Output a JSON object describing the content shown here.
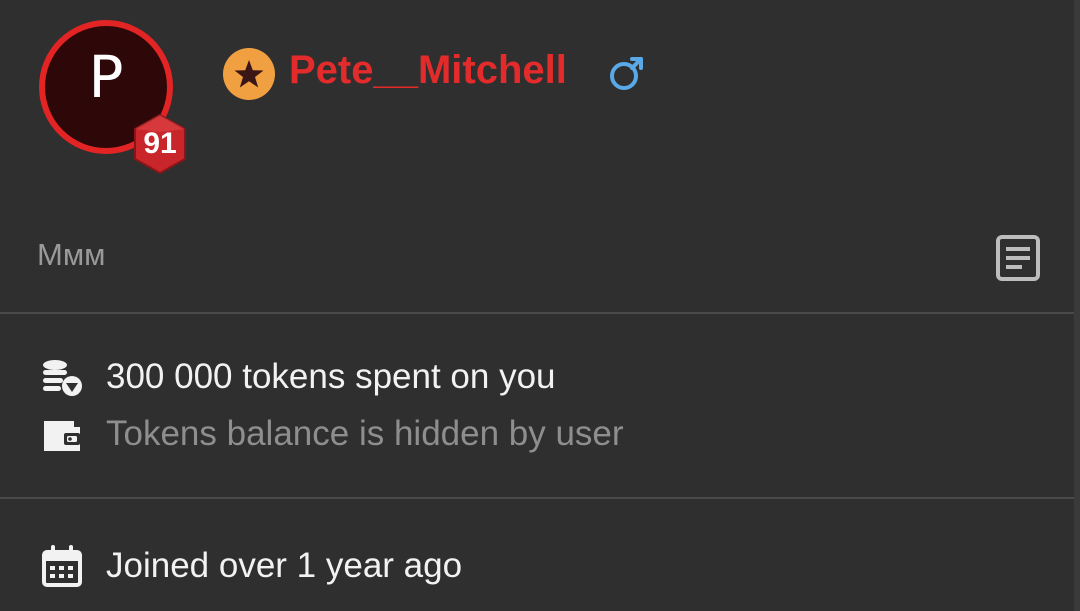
{
  "profile": {
    "avatar_letter": "P",
    "level": "91",
    "username": "Pete__Mitchell",
    "gender_icon": "male-symbol-icon",
    "about": "Ммм"
  },
  "stats": {
    "tokens_spent": "300 000 tokens spent on you",
    "tokens_balance": "Tokens balance is hidden by user",
    "joined": "Joined over 1 year ago"
  },
  "colors": {
    "background": "#2f2f2f",
    "username": "#e32b2b",
    "avatar_ring": "#e32424",
    "star_badge": "#f0a040",
    "gender_icon": "#5aa8e6",
    "muted_text": "#8e8e8e"
  }
}
